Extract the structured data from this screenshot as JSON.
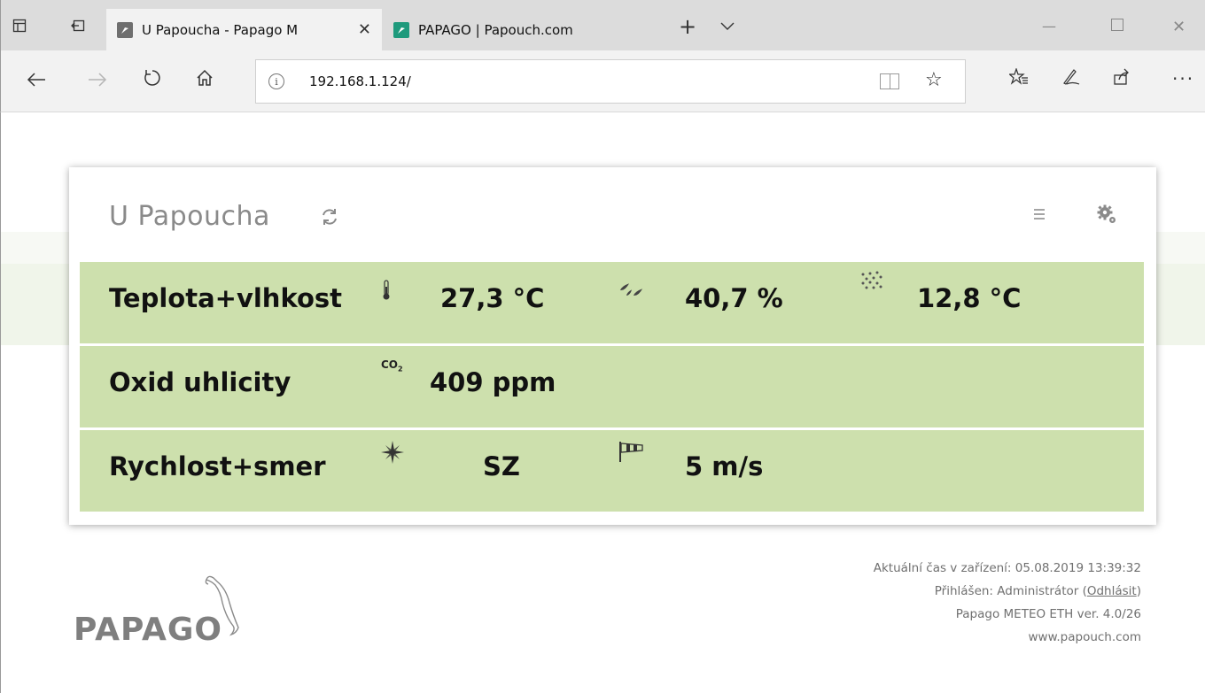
{
  "browser": {
    "tabs": [
      {
        "title": "U Papoucha - Papago M",
        "favicon_color": "#6f6f6f",
        "active": true
      },
      {
        "title": "PAPAGO | Papouch.com",
        "favicon_color": "#1e9a7c",
        "active": false
      }
    ],
    "address": "192.168.1.124/"
  },
  "card": {
    "title": "U Papoucha",
    "rows": [
      {
        "label": "Teplota+vlhkost",
        "values": [
          "27,3 °C",
          "40,7 %",
          "12,8 °C"
        ],
        "icons": [
          "thermometer-icon",
          "humidity-drops-icon",
          "dew-point-icon"
        ]
      },
      {
        "label": "Oxid uhlicity",
        "values": [
          "409 ppm"
        ],
        "icons": [
          "co2-icon"
        ]
      },
      {
        "label": "Rychlost+smer",
        "values": [
          "SZ",
          "5 m/s"
        ],
        "icons": [
          "compass-rose-icon",
          "windsock-icon"
        ]
      }
    ],
    "row_color": "#cde0ad"
  },
  "footer": {
    "time_label": "Aktuální čas v zařízení: 05.08.2019 13:39:32",
    "login_prefix": "Přihlášen: Administrátor (",
    "logout": "Odhlásit",
    "login_suffix": ")",
    "version": "Papago METEO ETH ver. 4.0/26",
    "website": "www.papouch.com"
  },
  "logo": {
    "text": "PAPAGO"
  }
}
